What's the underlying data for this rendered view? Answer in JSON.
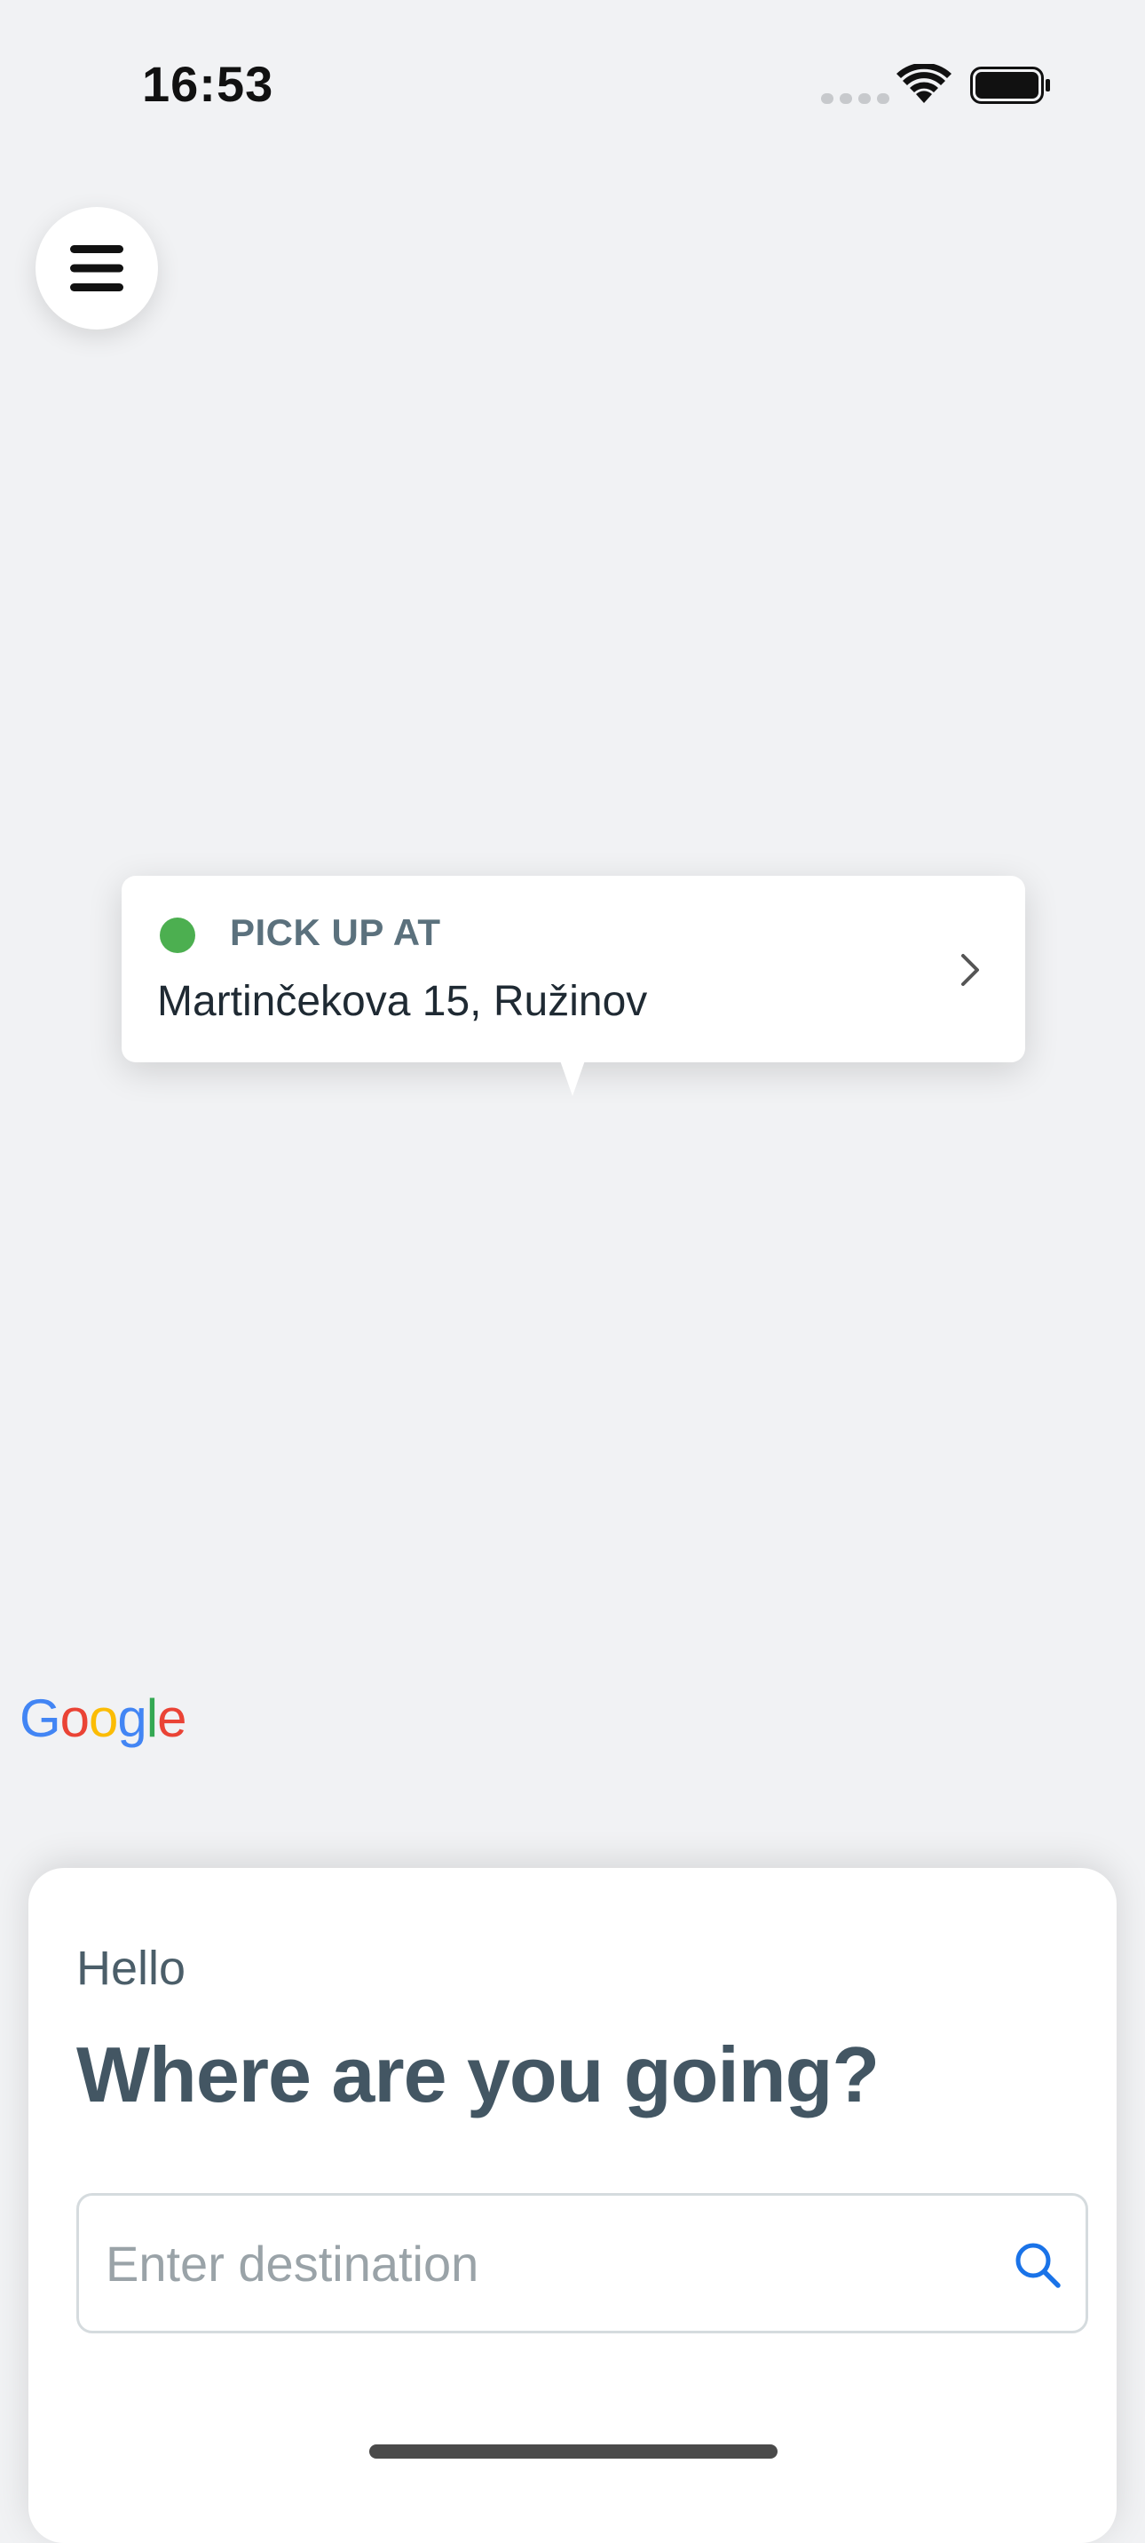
{
  "status_bar": {
    "time": "16:53"
  },
  "menu": {
    "icon": "hamburger-menu-icon"
  },
  "pickup": {
    "label": "PICK UP AT",
    "address": "Martinčekova 15, Ružinov",
    "dot_color": "#4caf50",
    "chevron_icon": "chevron-right-icon"
  },
  "map": {
    "attribution": [
      "G",
      "o",
      "o",
      "g",
      "l",
      "e"
    ],
    "attribution_colors": [
      "#4285F4",
      "#EA4335",
      "#FBBC05",
      "#4285F4",
      "#34A853",
      "#EA4335"
    ]
  },
  "sheet": {
    "greeting": "Hello",
    "headline": "Where are you going?",
    "search": {
      "placeholder": "Enter destination",
      "value": "",
      "icon": "search-icon",
      "icon_color": "#1a73e8"
    }
  }
}
